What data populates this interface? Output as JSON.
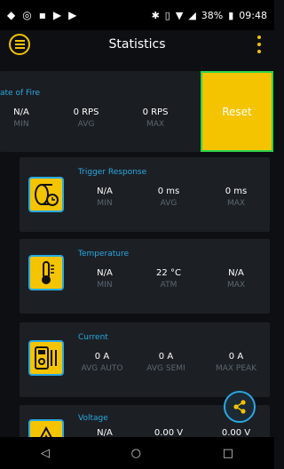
{
  "status_bar": {
    "battery": "38%",
    "time": "09:48"
  },
  "header": {
    "title": "Statistics"
  },
  "rate_of_fire": {
    "label": "ate of Fire",
    "values": [
      "N/A",
      "0 RPS",
      "0 RPS"
    ],
    "sublabels": [
      "MIN",
      "AVG",
      "MAX"
    ]
  },
  "reset_label": "Reset",
  "trigger_response": {
    "label": "Trigger Response",
    "values": [
      "N/A",
      "0 ms",
      "0 ms"
    ],
    "sublabels": [
      "MIN",
      "AVG",
      "MAX"
    ]
  },
  "temperature": {
    "label": "Temperature",
    "values": [
      "N/A",
      "22 °C",
      "N/A"
    ],
    "sublabels": [
      "MIN",
      "ATM",
      "MAX"
    ]
  },
  "current": {
    "label": "Current",
    "values": [
      "0 A",
      "0 A",
      "0 A"
    ],
    "sublabels": [
      "AVG AUTO",
      "AVG SEMI",
      "MAX PEAK"
    ]
  },
  "voltage": {
    "label": "Voltage",
    "values": [
      "N/A",
      "0.00 V",
      "0.00 V"
    ]
  },
  "icons": {
    "menu": "menu-icon",
    "more": "more-vert-icon",
    "trigger": "trigger-timer-icon",
    "thermometer": "thermometer-icon",
    "multimeter": "multimeter-icon",
    "voltage": "voltage-icon",
    "share": "share-icon",
    "nav_back": "nav-back-icon",
    "nav_home": "nav-home-icon",
    "nav_recent": "nav-recent-icon"
  },
  "colors": {
    "accent": "#f5c400",
    "blue": "#2aa8e0",
    "reset_border": "#2fd44a"
  }
}
